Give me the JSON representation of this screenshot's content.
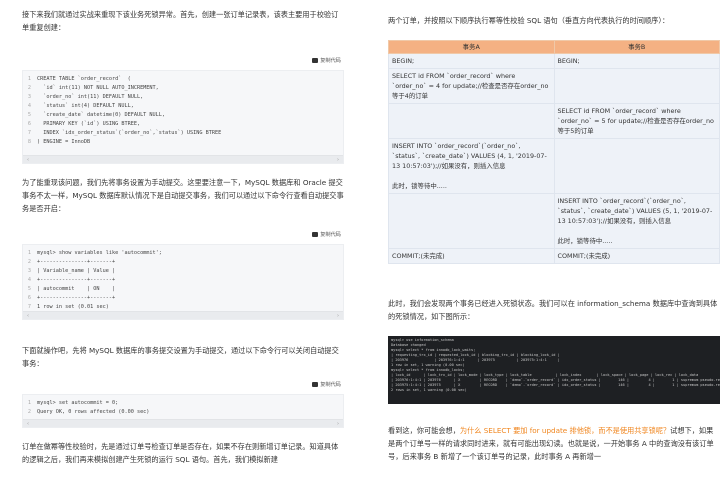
{
  "left": {
    "p1": "接下来我们就通过实战来重现下该业务死锁异常。首先，创建一张订单记录表，该表主要用于校验订单重复创建：",
    "copy_label": "复制代码",
    "code1": [
      "CREATE TABLE `order_record`  (",
      "  `id` int(11) NOT NULL AUTO_INCREMENT,",
      "  `order_no` int(11) DEFAULT NULL,",
      "  `status` int(4) DEFAULT NULL,",
      "  `create_date` datetime(0) DEFAULT NULL,",
      "  PRIMARY KEY (`id`) USING BTREE,",
      "  INDEX `idx_order_status`(`order_no`,`status`) USING BTREE",
      ") ENGINE = InnoDB"
    ],
    "p2": "为了能重现该问题，我们先将事务设置为手动提交。这里要注意一下，MySQL 数据库和 Oracle 提交事务不太一样，MySQL 数据库默认情况下是自动提交事务，我们可以通过以下命令行查看自动提交事务是否开启：",
    "code2": [
      "mysql> show variables like 'autocommit';",
      "+---------------+-------+",
      "| Variable_name | Value |",
      "+---------------+-------+",
      "| autocommit    | ON    |",
      "+---------------+-------+",
      "1 row in set (0.01 sec)"
    ],
    "p3": "下面就操作吧，先将 MySQL 数据库的事务提交设置为手动提交，通过以下命令行可以关闭自动提交事务：",
    "code3": [
      "mysql> set autocommit = 0;",
      "Query OK, 0 rows affected (0.00 sec)"
    ],
    "p4": "订单在做幂等性校验时，先是通过订单号检查订单是否存在，如果不存在则新增订单记录。知道具体的逻辑之后，我们再来模拟创建产生死锁的运行 SQL 语句。首先，我们模拟新建"
  },
  "right": {
    "p1": "两个订单，并按照以下顺序执行幂等性校验 SQL 语句（垂直方向代表执行的时间顺序）：",
    "table_headers": [
      "事务A",
      "事务B"
    ],
    "table_rows": [
      [
        "BEGIN;",
        "BEGIN;"
      ],
      [
        "SELECT id FROM `order_record` where `order_no` = 4 for update;//检查是否存在order_no等于4的订单",
        ""
      ],
      [
        "",
        "SELECT id FROM `order_record` where `order_no` = 5 for update;//检查是否存在order_no等于5的订单"
      ],
      [
        "INSERT INTO `order_record`(`order_no`, `status`, `create_date`) VALUES (4, 1, '2019-07-13 10:57:03');//如果没有，则插入信息\n\n此时，锁等待中.....",
        ""
      ],
      [
        "",
        "INSERT INTO `order_record`(`order_no`, `status`, `create_date`) VALUES (5, 1, '2019-07-13 10:57:03');//如果没有，则插入信息\n\n此时，锁等待中....."
      ],
      [
        "COMMIT;(未完成)",
        "COMMIT;(未完成)"
      ]
    ],
    "p2": "此时，我们会发现两个事务已经进入死锁状态。我们可以在 information_schema 数据库中查询到具体的死锁情况，如下图所示：",
    "terminal_lines": [
      "mysql> use information_schema",
      "Database changed",
      "mysql> select * from innodb_lock_waits;",
      "| requesting_trx_id | requested_lock_id | blocking_trx_id | blocking_lock_id |",
      "| 203976            | 203976:1:4:1      | 203975          | 203975:1:4:1     |",
      "1 row in set, 1 warning (0.00 sec)",
      "mysql> select * from innodb_locks;",
      "| lock_id      | lock_trx_id | lock_mode | lock_type | lock_table           | lock_index       | lock_space | lock_page | lock_rec | lock_data              |",
      "| 203976:1:4:1 | 203976      | X         | RECORD    | `demo`.`order_record` | idx_order_status |        146 |         4 |        1 | supremum pseudo-record |",
      "| 203975:1:4:1 | 203975      | X         | RECORD    | `demo`.`order_record` | idx_order_status |        146 |         4 |        1 | supremum pseudo-record |",
      "2 rows in set, 1 warning (0.00 sec)"
    ],
    "p3_a": "看到这，你可能会想，",
    "p3_hl": "为什么 SELECT 要加 for update 排他锁，而不是使用共享锁呢？",
    "p3_b": "试想下，如果是两个订单号一样的请求同时进来，就有可能出现幻读。也就是说，一开始事务 A 中的查询没有该订单号，后来事务 B 新增了一个该订单号的记录，此时事务 A 再新增一"
  }
}
